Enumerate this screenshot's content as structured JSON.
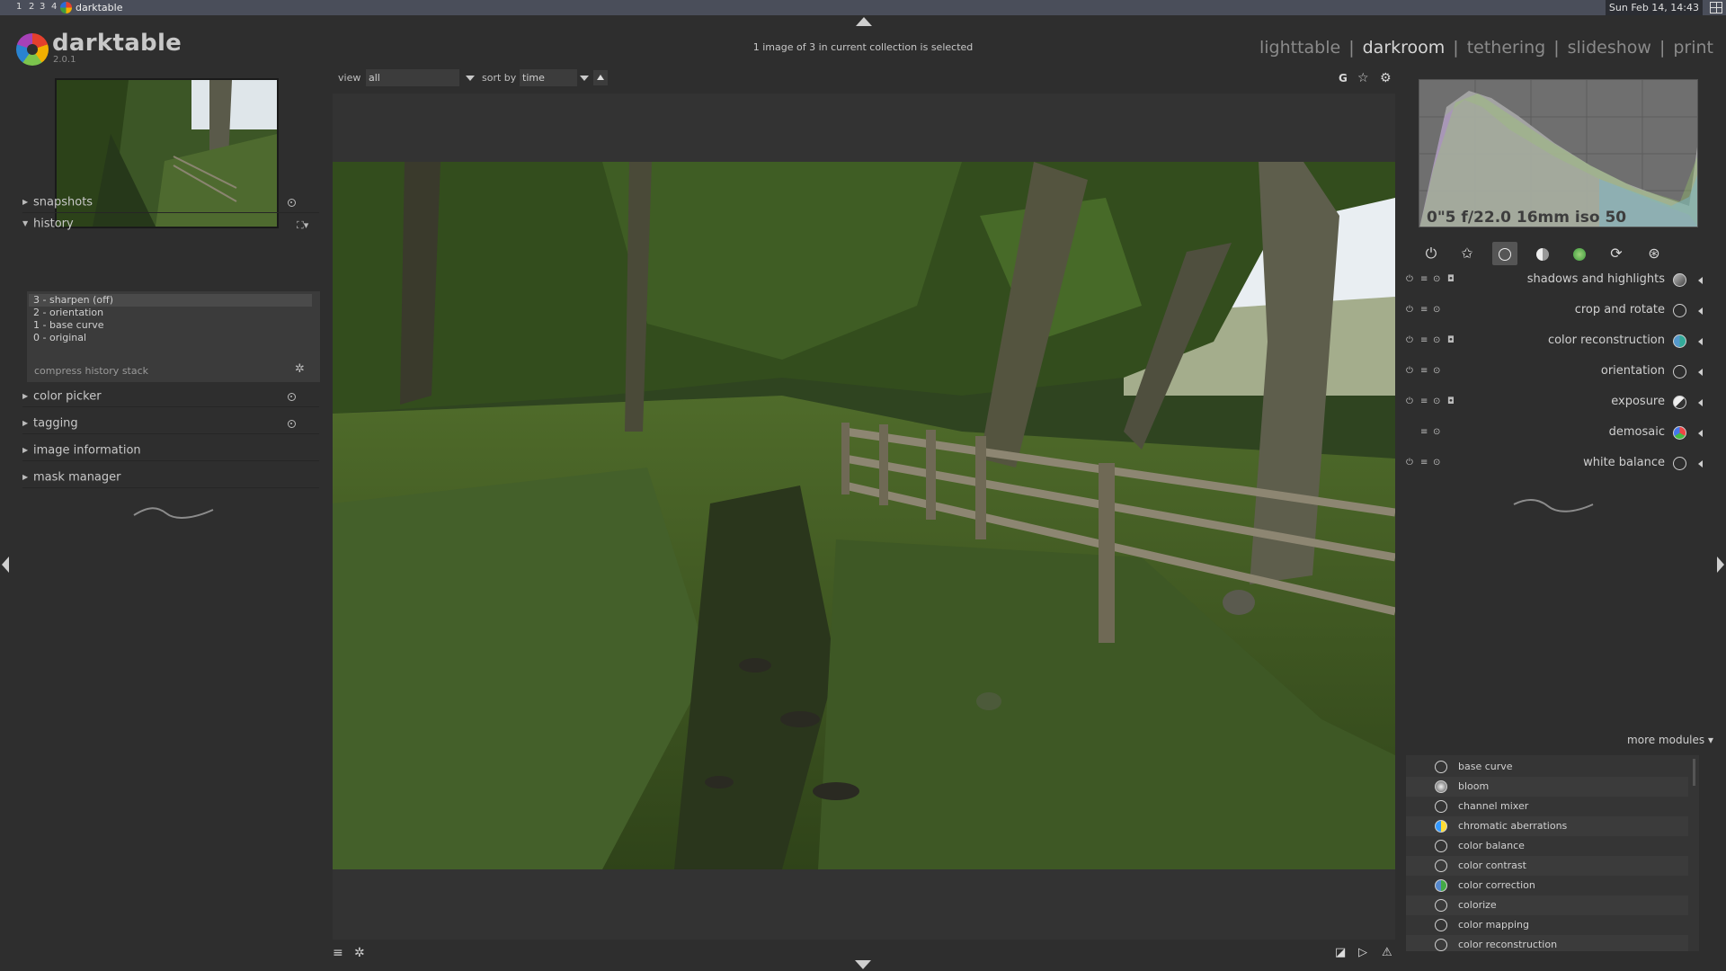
{
  "os_bar": {
    "workspaces": [
      "1",
      "2",
      "3",
      "4"
    ],
    "window_title": "darktable",
    "clock": "Sun Feb 14, 14:43"
  },
  "header": {
    "logo_text": "darktable",
    "version": "2.0.1",
    "selection_message": "1 image of 3 in current collection is selected",
    "views": [
      "lighttable",
      "darkroom",
      "tethering",
      "slideshow",
      "print"
    ],
    "active_view": "darkroom",
    "view_separator": "|"
  },
  "filter_bar": {
    "view_label": "view",
    "view_value": "all",
    "sort_label": "sort by",
    "sort_value": "time",
    "right_icons": [
      "G",
      "star-icon",
      "gear-icon"
    ]
  },
  "left_panel": {
    "sections": {
      "snapshots": "snapshots",
      "history": "history",
      "color_picker": "color picker",
      "tagging": "tagging",
      "image_information": "image information",
      "mask_manager": "mask manager"
    },
    "history_items": [
      "3 - sharpen  (off)",
      "2 - orientation",
      "1 - base curve",
      "0 - original"
    ],
    "compress_label": "compress history stack"
  },
  "right_panel": {
    "histogram_info": "0\"5 f/22.0 16mm iso 50",
    "module_groups": [
      "power-icon",
      "star-icon",
      "circle-icon",
      "tone-icon",
      "color-icon",
      "correct-icon",
      "effect-icon"
    ],
    "modules": [
      "shadows and highlights",
      "crop and rotate",
      "color reconstruction",
      "orientation",
      "exposure",
      "demosaic",
      "white balance"
    ],
    "more_modules_label": "more modules",
    "more_modules_list": [
      "base curve",
      "bloom",
      "channel mixer",
      "chromatic aberrations",
      "color balance",
      "color contrast",
      "color correction",
      "colorize",
      "color mapping",
      "color reconstruction"
    ]
  },
  "colors": {
    "background": "#2e2e2e",
    "panel_text": "#c8c8c8",
    "os_bar": "#4a4e5a"
  }
}
